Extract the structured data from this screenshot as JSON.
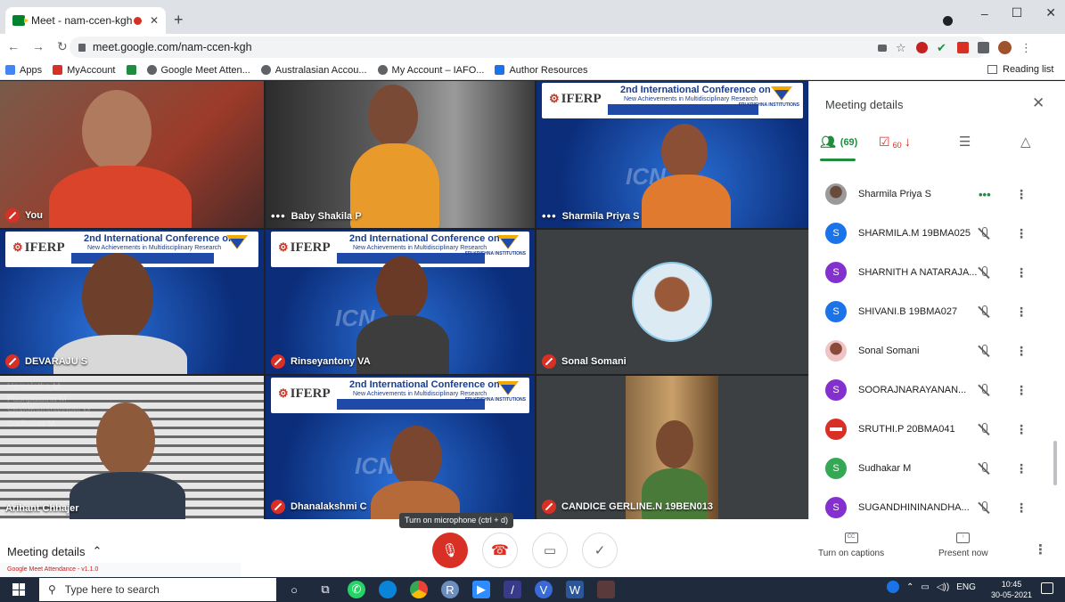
{
  "browser": {
    "tab_title": "Meet - nam-ccen-kgh",
    "tab_close": "✕",
    "new_tab": "+",
    "url": "meet.google.com/nam-ccen-kgh",
    "window_controls": [
      "–",
      "☐",
      "✕"
    ],
    "bookmarks": [
      {
        "label": "Apps",
        "icon": "apps-grid-icon",
        "color": "#4285f4"
      },
      {
        "label": "MyAccount",
        "icon": "red-triangle-icon",
        "color": "#d93025"
      },
      {
        "label": "",
        "icon": "checkmark-icon",
        "color": "#1e8e3e"
      },
      {
        "label": "Google Meet Atten...",
        "icon": "globe-icon",
        "color": "#5f6368"
      },
      {
        "label": "Australasian Accou...",
        "icon": "link-icon",
        "color": "#5f6368"
      },
      {
        "label": "My Account – IAFO...",
        "icon": "globe-icon",
        "color": "#5f6368"
      },
      {
        "label": "Author Resources",
        "icon": "author-m-icon",
        "color": "#1a73e8"
      }
    ],
    "reading_list": "Reading list"
  },
  "meeting": {
    "tiles": [
      {
        "name": "You",
        "muted": true,
        "more": false
      },
      {
        "name": "Baby Shakila P",
        "muted": false,
        "more": true
      },
      {
        "name": "Sharmila Priya S",
        "muted": false,
        "more": true
      },
      {
        "name": "DEVARAJU S",
        "muted": true,
        "more": false
      },
      {
        "name": "Rinseyantony VA",
        "muted": true,
        "more": false
      },
      {
        "name": "Sonal Somani",
        "muted": true,
        "more": false
      },
      {
        "name": "Arihant Chhajer",
        "muted": false,
        "more": false
      },
      {
        "name": "Dhanalakshmi C",
        "muted": true,
        "more": false
      },
      {
        "name": "CANDICE GERLINE.N 19BEN013",
        "muted": true,
        "more": false
      }
    ],
    "banner": {
      "org": "IFERP",
      "title": "2nd International Conference on",
      "subtitle": "New Achievements in Multidisciplinary Research",
      "sponsor": "SRI KRISHNA INSTITUTIONS",
      "watermark": "ICN"
    },
    "ghost_names": [
      "Hemalatha M",
      "Pushpalatha M",
      "Shanthanalakshmi M",
      "Sudhakar M",
      "Reena R",
      "Vijayasarvandeswari R"
    ],
    "tooltip": "Turn on microphone (ctrl + d)",
    "meeting_details_label": "Meeting details",
    "extension_bar": "Google Meet Attendance - v1.1.0"
  },
  "panel": {
    "title": "Meeting details",
    "people_count": "(69)",
    "attendance_count": "60",
    "participants": [
      {
        "name": "Sharmila Priya S",
        "initial": "",
        "color": "#5f6368",
        "photo": true,
        "state": "speaking"
      },
      {
        "name": "SHARMILA.M 19BMA025",
        "initial": "S",
        "color": "#1a73e8",
        "photo": false,
        "state": "muted"
      },
      {
        "name": "SHARNITH A NATARAJA...",
        "initial": "S",
        "color": "#8430ce",
        "photo": false,
        "state": "muted"
      },
      {
        "name": "SHIVANI.B 19BMA027",
        "initial": "S",
        "color": "#1a73e8",
        "photo": false,
        "state": "muted"
      },
      {
        "name": "Sonal Somani",
        "initial": "",
        "color": "#e8a0a0",
        "photo": true,
        "state": "muted"
      },
      {
        "name": "SOORAJNARAYANAN...",
        "initial": "S",
        "color": "#8430ce",
        "photo": false,
        "state": "muted"
      },
      {
        "name": "SRUTHI.P 20BMA041",
        "initial": "",
        "color": "#d93025",
        "photo": false,
        "state": "muted",
        "noentry": true
      },
      {
        "name": "Sudhakar M",
        "initial": "S",
        "color": "#34a853",
        "photo": false,
        "state": "muted"
      },
      {
        "name": "SUGANDHININANDHA...",
        "initial": "S",
        "color": "#8430ce",
        "photo": false,
        "state": "muted"
      }
    ],
    "captions_label": "Turn on captions",
    "present_label": "Present now"
  },
  "taskbar": {
    "search_placeholder": "Type here to search",
    "language": "ENG",
    "time": "10:45",
    "date": "30-05-2021"
  }
}
